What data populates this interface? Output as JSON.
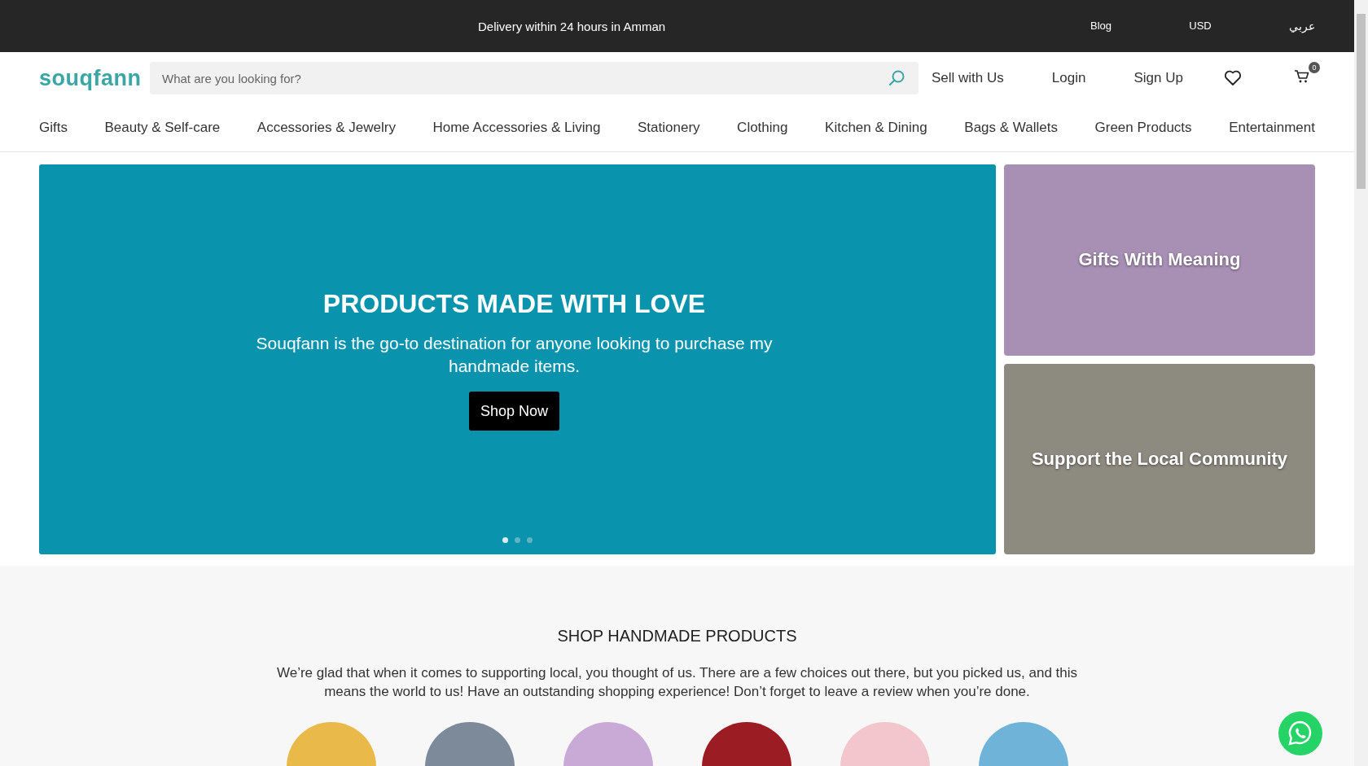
{
  "top_bar": {
    "message": "Delivery within 24 hours in Amman",
    "links": [
      "Blog",
      "USD",
      "عربي"
    ]
  },
  "header": {
    "logo": "souqfann",
    "search": {
      "placeholder": "What are you looking for?"
    },
    "links": [
      "Sell with Us",
      "Login",
      "Sign Up"
    ],
    "cart_count": "0"
  },
  "nav": [
    "Gifts",
    "Beauty & Self-care",
    "Accessories & Jewelry",
    "Home Accessories & Living",
    "Stationery",
    "Clothing",
    "Kitchen & Dining",
    "Bags & Wallets",
    "Green Products",
    "Entertainment"
  ],
  "hero": {
    "title": "PRODUCTS MADE WITH LOVE",
    "text": "Souqfann is the go-to destination for anyone looking to purchase my handmade items.",
    "button": "Shop Now",
    "dots": [
      {
        "selected": true
      },
      {
        "selected": false
      },
      {
        "selected": false
      }
    ]
  },
  "promos": [
    {
      "title": "Gifts With Meaning",
      "color": "#a88fb4"
    },
    {
      "title": "Support the Local Community",
      "color": "#8d8a80"
    }
  ],
  "section": {
    "title": "SHOP HANDMADE PRODUCTS",
    "text": "We’re glad that when it comes to supporting local, you thought of us. There are a few choices out there, but you picked us, and this means the world to us! Have an outstanding shopping experience! Don’t forget to leave a review when you’re done.",
    "categories": [
      {
        "color": "#e9b94a"
      },
      {
        "color": "#7d8a9a"
      },
      {
        "color": "#c9a9d6"
      },
      {
        "color": "#9b1c22"
      },
      {
        "color": "#f2c6cc"
      },
      {
        "color": "#6fb3d9"
      }
    ]
  }
}
